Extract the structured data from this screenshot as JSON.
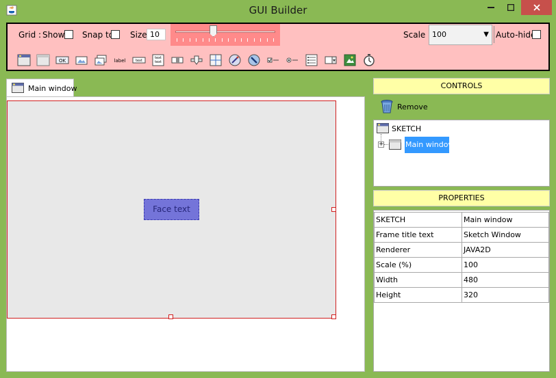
{
  "window": {
    "title": "GUI Builder"
  },
  "toolbar": {
    "grid_label": "Grid :",
    "show_label": "Show",
    "snap_label": "Snap to",
    "size_label": "Size",
    "size_value": "10",
    "slider_value": 10,
    "scale_label": "Scale :",
    "scale_value": "100",
    "autohide_label": "Auto-hide",
    "palette": [
      "window-icon",
      "panel-icon",
      "ok-button-icon",
      "image-button-icon",
      "imagebutton-stack-icon",
      "label-icon",
      "textfield-icon",
      "textarea-icon",
      "toggle-icon",
      "knob-icon",
      "crosshair-icon",
      "wand-icon",
      "pick-icon",
      "checkbox-icon",
      "radio-icon",
      "option-list-icon",
      "dropdown-icon",
      "image-icon",
      "timer-icon"
    ],
    "label_icon_text": "label",
    "text_icon_text": "text"
  },
  "tab": {
    "label": "Main window"
  },
  "sketch": {
    "face_text": "Face text"
  },
  "controls": {
    "header": "CONTROLS",
    "remove_label": "Remove",
    "tree": {
      "root": "SKETCH",
      "child": "Main window"
    }
  },
  "properties": {
    "header": "PROPERTIES",
    "rows": [
      {
        "key": "SKETCH",
        "value": "Main window"
      },
      {
        "key": "Frame title text",
        "value": "Sketch Window"
      },
      {
        "key": "Renderer",
        "value": "JAVA2D"
      },
      {
        "key": "Scale (%)",
        "value": "100"
      },
      {
        "key": "Width",
        "value": "480"
      },
      {
        "key": "Height",
        "value": "320"
      }
    ]
  },
  "colors": {
    "window_frame": "#8ab954",
    "toolbar_bg": "#ffc0c0",
    "slider_bg": "#ff8a8a",
    "close_button": "#c7504b",
    "selection": "#3399ff",
    "panel_header": "#ffffa6",
    "frame_border": "#d01e1e",
    "face_button": "#7474d9"
  }
}
